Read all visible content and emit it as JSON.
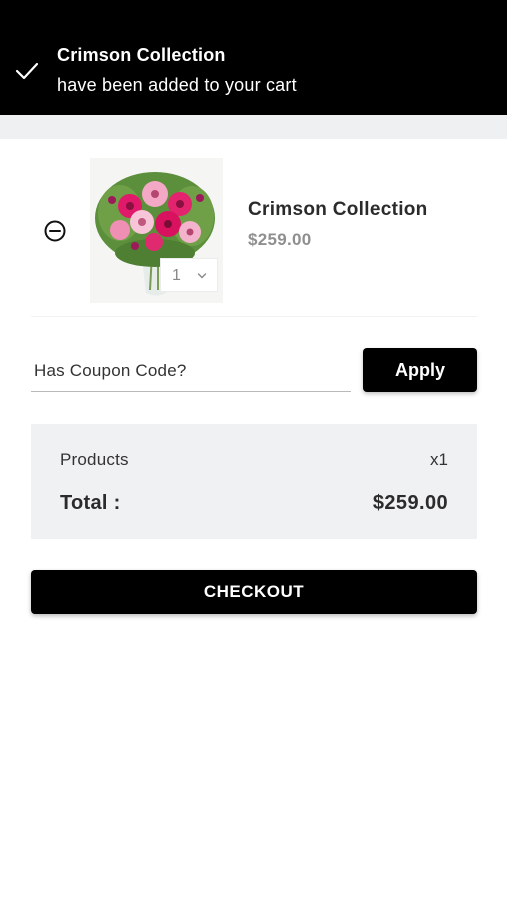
{
  "toast": {
    "title": "Crimson Collection",
    "message": "have been added to your cart"
  },
  "cart": {
    "items": [
      {
        "name": "Crimson Collection",
        "price": "$259.00",
        "quantity": "1"
      }
    ]
  },
  "coupon": {
    "placeholder": "Has Coupon Code?",
    "apply_label": "Apply"
  },
  "summary": {
    "products_label": "Products",
    "products_count": "x1",
    "total_label": "Total :",
    "total_value": "$259.00"
  },
  "checkout": {
    "label": "CHECKOUT"
  },
  "colors": {
    "primary": "#000000",
    "summary_bg": "#eff1f2",
    "muted_price": "#8f8f8f"
  },
  "icons": {
    "toast": "check-icon",
    "remove": "minus-circle-icon",
    "quantity": "chevron-down-icon"
  }
}
